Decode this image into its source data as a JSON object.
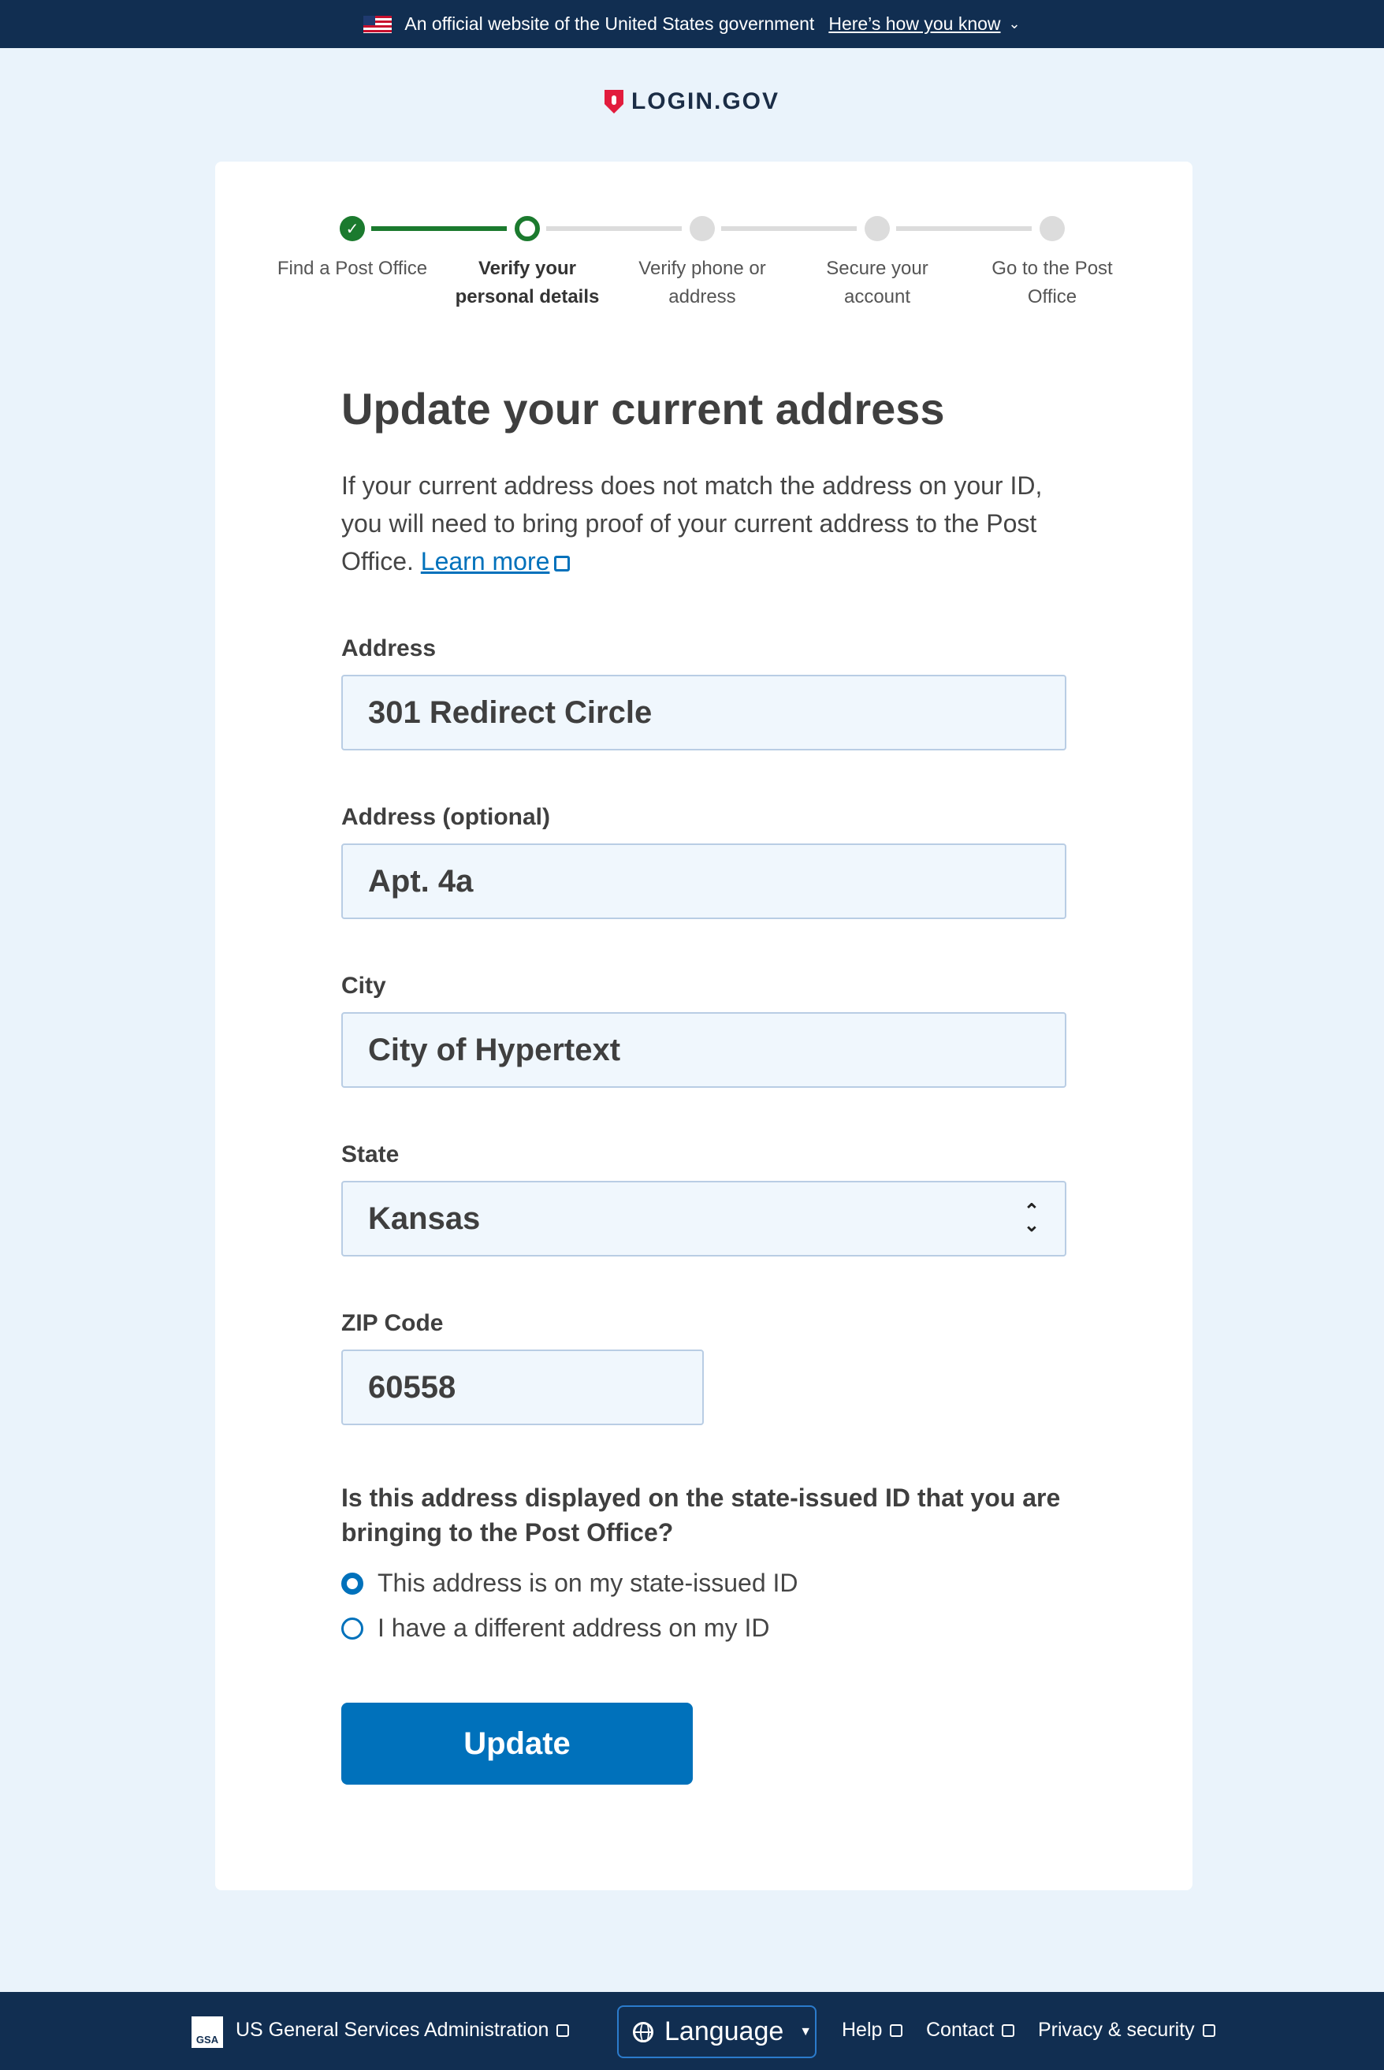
{
  "banner": {
    "text": "An official website of the United States government",
    "link": "Here’s how you know"
  },
  "logo": {
    "text": "LOGIN.GOV"
  },
  "steps": [
    {
      "label": "Find a Post Office",
      "state": "complete"
    },
    {
      "label": "Verify your personal details",
      "state": "current"
    },
    {
      "label": "Verify phone or address",
      "state": "upcoming"
    },
    {
      "label": "Secure your account",
      "state": "upcoming"
    },
    {
      "label": "Go to the Post Office",
      "state": "upcoming"
    }
  ],
  "form": {
    "title": "Update your current address",
    "intro": "If your current address does not match the address on your ID, you will need to bring proof of your current address to the Post Office.",
    "learn_more": "Learn more",
    "address1": {
      "label": "Address",
      "value": "301 Redirect Circle"
    },
    "address2": {
      "label": "Address (optional)",
      "value": "Apt. 4a"
    },
    "city": {
      "label": "City",
      "value": "City of Hypertext"
    },
    "state": {
      "label": "State",
      "value": "Kansas"
    },
    "zip": {
      "label": "ZIP Code",
      "value": "60558"
    },
    "question": "Is this address displayed on the state-issued ID that you are bringing to the Post Office?",
    "options": [
      {
        "label": "This address is on my state-issued ID",
        "checked": true
      },
      {
        "label": "I have a different address on my ID",
        "checked": false
      }
    ],
    "submit": "Update"
  },
  "footer": {
    "gsa_logo": "GSA",
    "gsa": "US General Services Administration",
    "language": "Language",
    "help": "Help",
    "contact": "Contact",
    "privacy": "Privacy & security"
  },
  "colors": {
    "navy": "#112e51",
    "primary": "#0071bb",
    "success": "#1b7a2e",
    "background": "#eaf3fb"
  }
}
